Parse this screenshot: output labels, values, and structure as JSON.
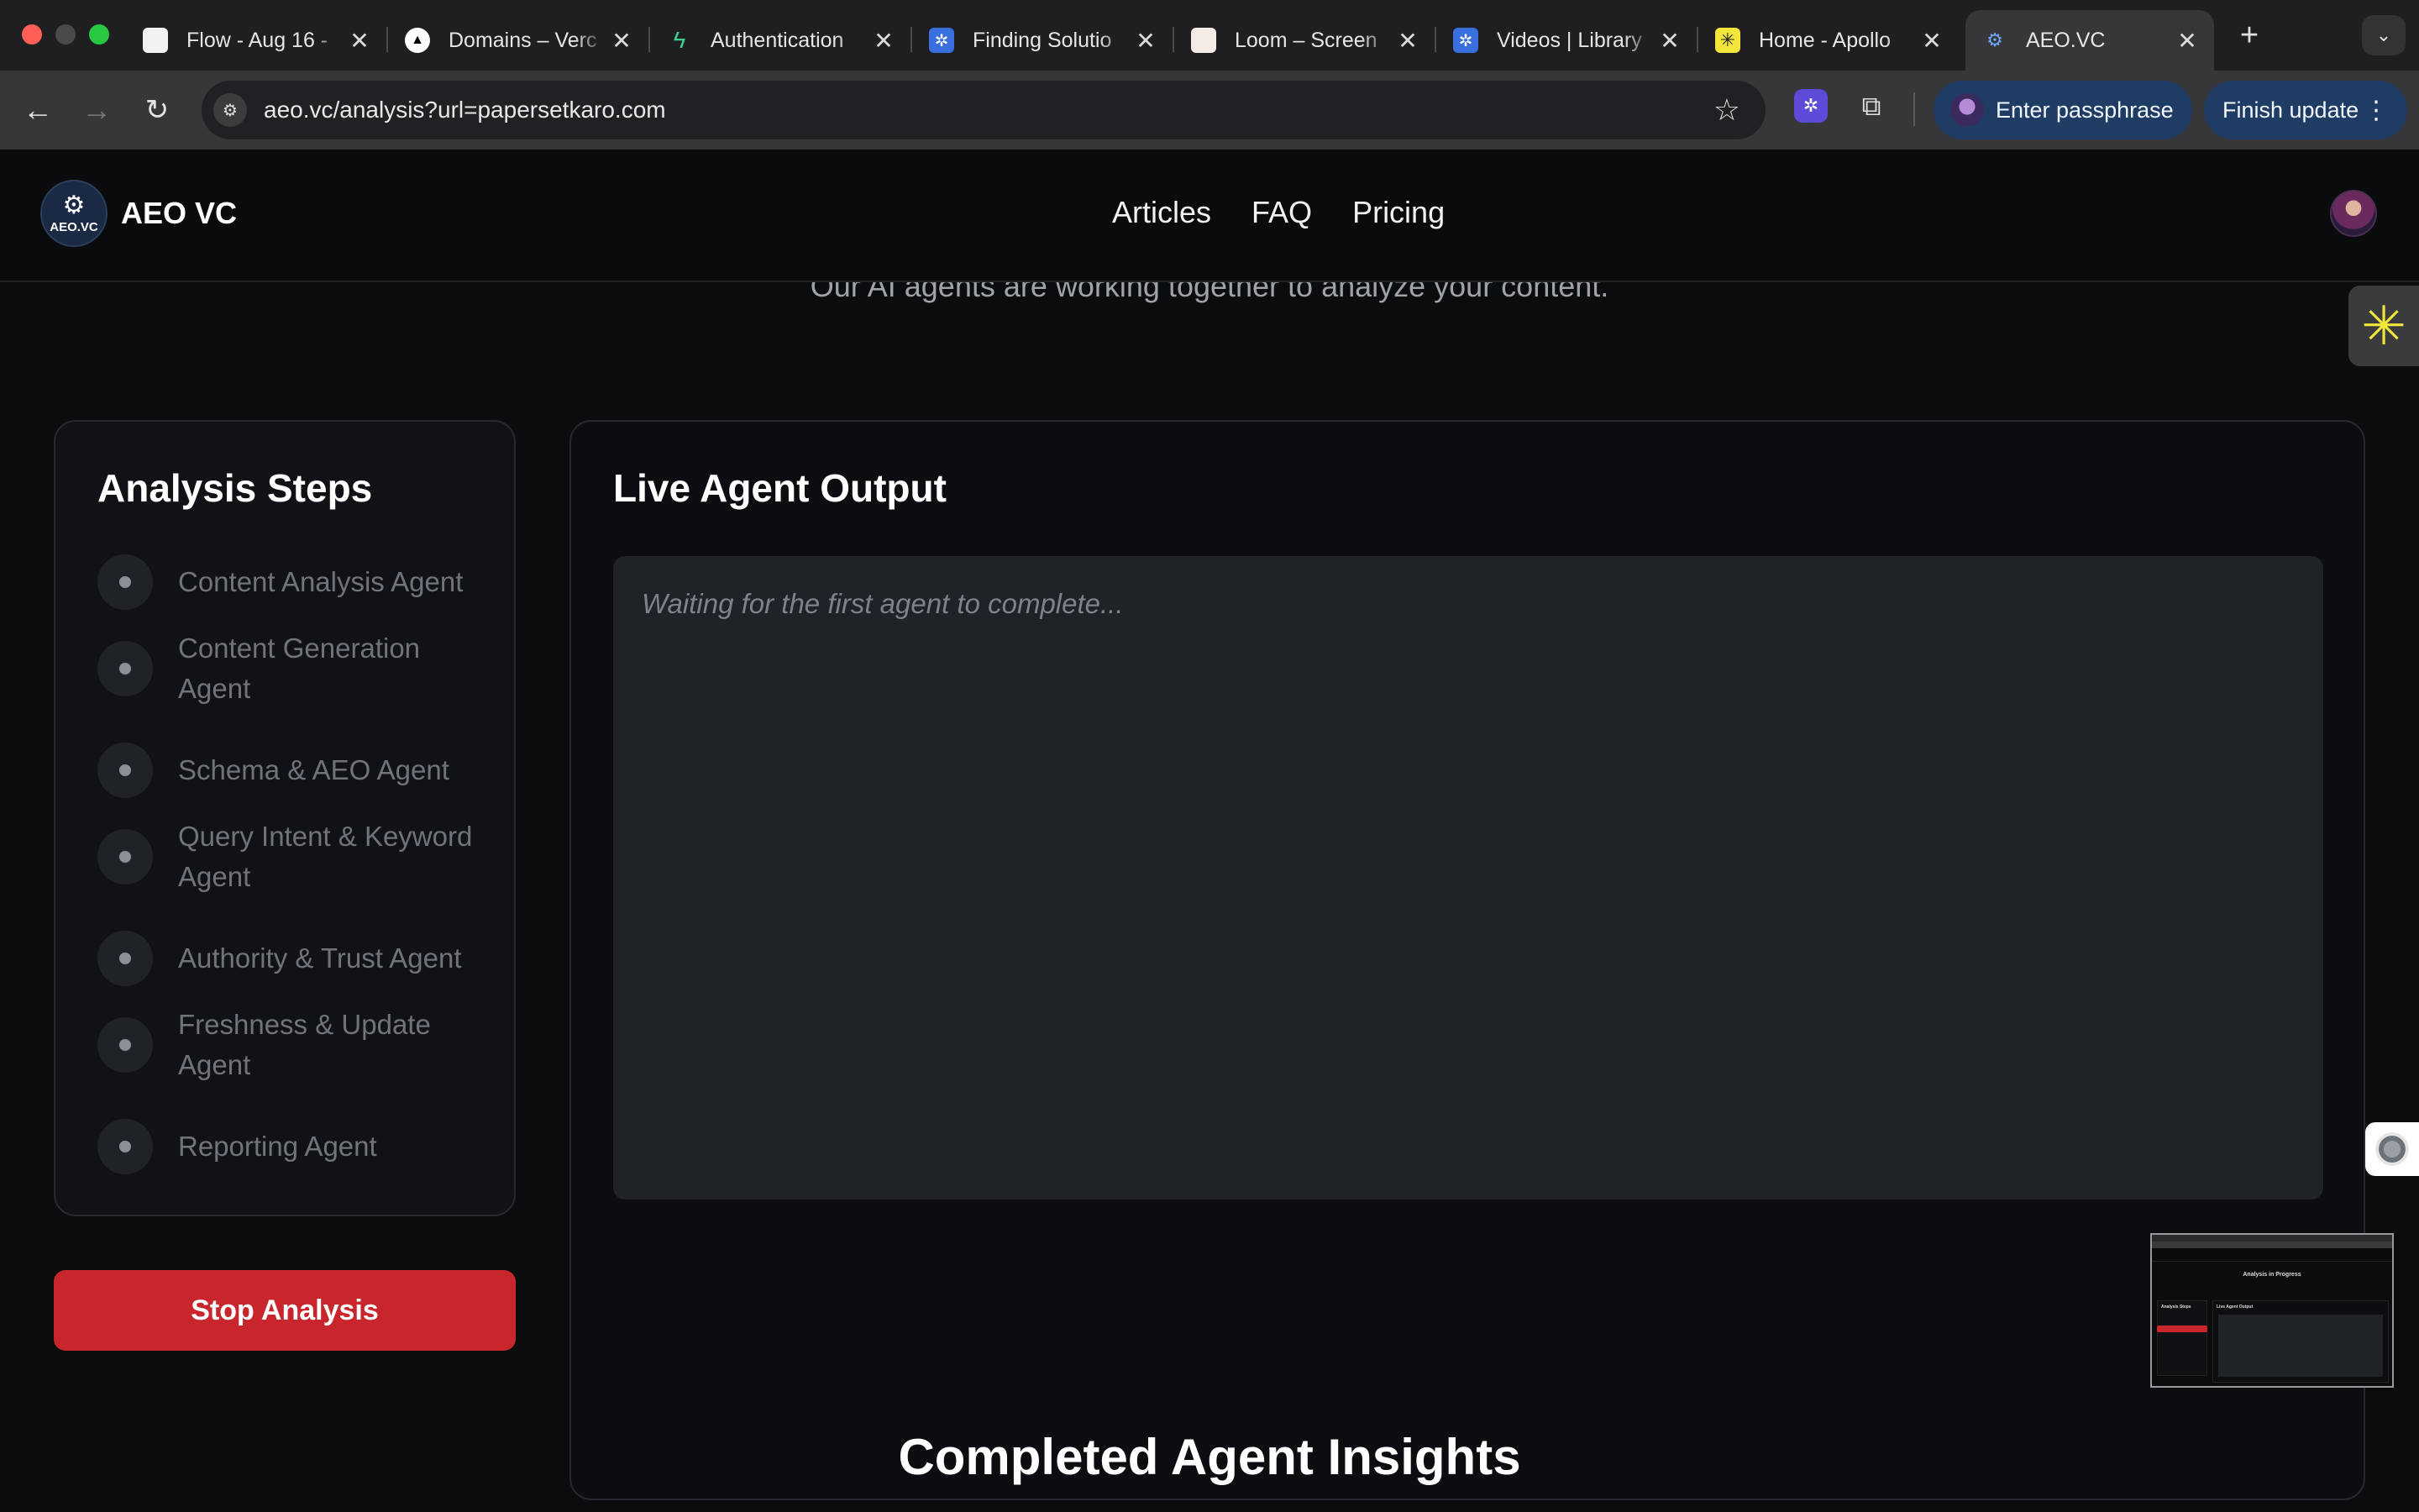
{
  "browser": {
    "tabs": [
      {
        "label": "Flow - Aug 16 -",
        "icon": "document-icon"
      },
      {
        "label": "Domains – Verc",
        "icon": "vercel-triangle-icon"
      },
      {
        "label": "Authentication",
        "icon": "supabase-bolt-icon"
      },
      {
        "label": "Finding Solutio",
        "icon": "gear-app-icon"
      },
      {
        "label": "Loom – Screen",
        "icon": "loom-icon"
      },
      {
        "label": "Videos | Library",
        "icon": "gear-app-icon"
      },
      {
        "label": "Home - Apollo",
        "icon": "apollo-icon"
      },
      {
        "label": "AEO.VC",
        "icon": "aeo-icon"
      }
    ],
    "url": "aeo.vc/analysis?url=papersetkaro.com",
    "profile_button": "Enter passphrase",
    "update_button": "Finish update"
  },
  "site": {
    "brand": "AEO VC",
    "logo_text": "AEO.VC",
    "nav": [
      "Articles",
      "FAQ",
      "Pricing"
    ]
  },
  "analysis": {
    "subtitle": "Our AI agents are working together to analyze your content.",
    "steps_title": "Analysis Steps",
    "steps": [
      "Content Analysis Agent",
      "Content Generation Agent",
      "Schema & AEO Agent",
      "Query Intent & Keyword Agent",
      "Authority & Trust Agent",
      "Freshness & Update Agent",
      "Reporting Agent"
    ],
    "stop_button": "Stop Analysis",
    "output_title": "Live Agent Output",
    "output_placeholder": "Waiting for the first agent to complete...",
    "insights_title": "Completed Agent Insights"
  },
  "thumbnail": {
    "title": "Analysis in Progress",
    "steps_title": "Analysis Steps",
    "output_title": "Live Agent Output"
  },
  "colors": {
    "background": "#0b0c0e",
    "stop_button": "#c8262c",
    "card_border": "#262a30",
    "output_box": "#1f2226"
  }
}
